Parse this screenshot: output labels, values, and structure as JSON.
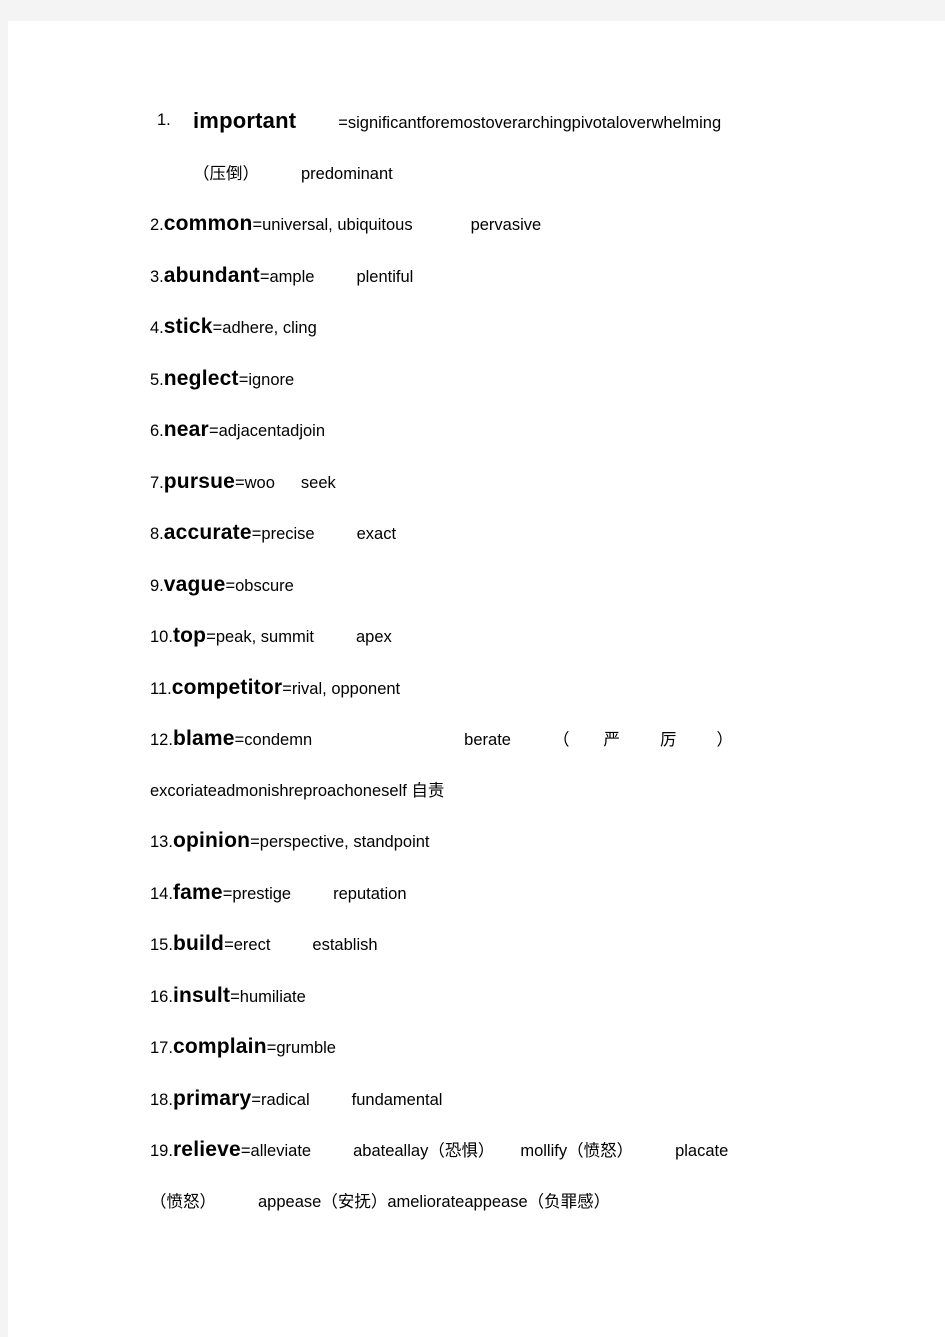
{
  "document": {
    "page_background": "#ffffff",
    "canvas_background": "#f4f4f4",
    "text_color": "#000000"
  },
  "entries": [
    {
      "number": "1.",
      "headword": "important",
      "equals": "=",
      "synonyms": "significantforemostoverarchingpivotaloverwhelming",
      "line2_cjk": "（压倒）",
      "line2_word": "predominant"
    },
    {
      "number": "2.",
      "headword": "common",
      "equals": "=",
      "syn1": "universal,",
      "syn2": "ubiquitous",
      "syn3": "pervasive"
    },
    {
      "number": "3.",
      "headword": "abundant",
      "equals": "=",
      "syn1": "ample",
      "syn2": "plentiful"
    },
    {
      "number": "4.",
      "headword": "stick",
      "equals": "=",
      "syn1": "adhere,",
      "syn2": "cling"
    },
    {
      "number": "5.",
      "headword": "neglect",
      "equals": "=",
      "syn1": "ignore"
    },
    {
      "number": "6.",
      "headword": "near",
      "equals": "=",
      "syn1": "adjacentadjoin"
    },
    {
      "number": "7.",
      "headword": "pursue",
      "equals": "=",
      "syn1": "woo",
      "syn2": "seek"
    },
    {
      "number": "8.",
      "headword": "accurate",
      "equals": "=",
      "syn1": "precise",
      "syn2": "exact"
    },
    {
      "number": "9.",
      "headword": "vague",
      "equals": "=",
      "syn1": "obscure"
    },
    {
      "number": "10.",
      "headword": "top",
      "equals": "=",
      "syn1": "peak,",
      "syn2": "summit",
      "syn3": "apex"
    },
    {
      "number": "11.",
      "headword": "competitor",
      "equals": "=",
      "syn1": "rival,",
      "syn2": "opponent"
    },
    {
      "number": "12.",
      "headword": "blame",
      "equals": "=",
      "syn1": "condemn",
      "syn2": "berate",
      "paren_open": "（",
      "cjk1": "严",
      "cjk2": "厉",
      "paren_close": "）",
      "line2": "excoriateadmonishreproachoneself",
      "line2_cjk": "自责"
    },
    {
      "number": "13.",
      "headword": "opinion",
      "equals": "=",
      "syn1": "perspective,",
      "syn2": "standpoint"
    },
    {
      "number": "14.",
      "headword": "fame",
      "equals": "=",
      "syn1": "prestige",
      "syn2": "reputation"
    },
    {
      "number": "15.",
      "headword": "build",
      "equals": "=",
      "syn1": "erect",
      "syn2": "establish"
    },
    {
      "number": "16.",
      "headword": "insult",
      "equals": "=",
      "syn1": "humiliate"
    },
    {
      "number": "17.",
      "headword": "complain",
      "equals": "=",
      "syn1": "grumble"
    },
    {
      "number": "18.",
      "headword": "primary",
      "equals": "=",
      "syn1": "radical",
      "syn2": "fundamental"
    },
    {
      "number": "19.",
      "headword": "relieve",
      "equals": "=",
      "syn1": "alleviate",
      "syn2": "abateallay",
      "cjk2": "（恐惧）",
      "syn3": "mollify",
      "cjk3": "（愤怒）",
      "syn4": "placate",
      "cjk4": "（愤怒）",
      "syn5": "appease",
      "cjk5": "（安抚）",
      "syn6": "amelioratappease",
      "syn6_actual": "ameliorateappease",
      "cjk6": "（负罪感）"
    }
  ]
}
